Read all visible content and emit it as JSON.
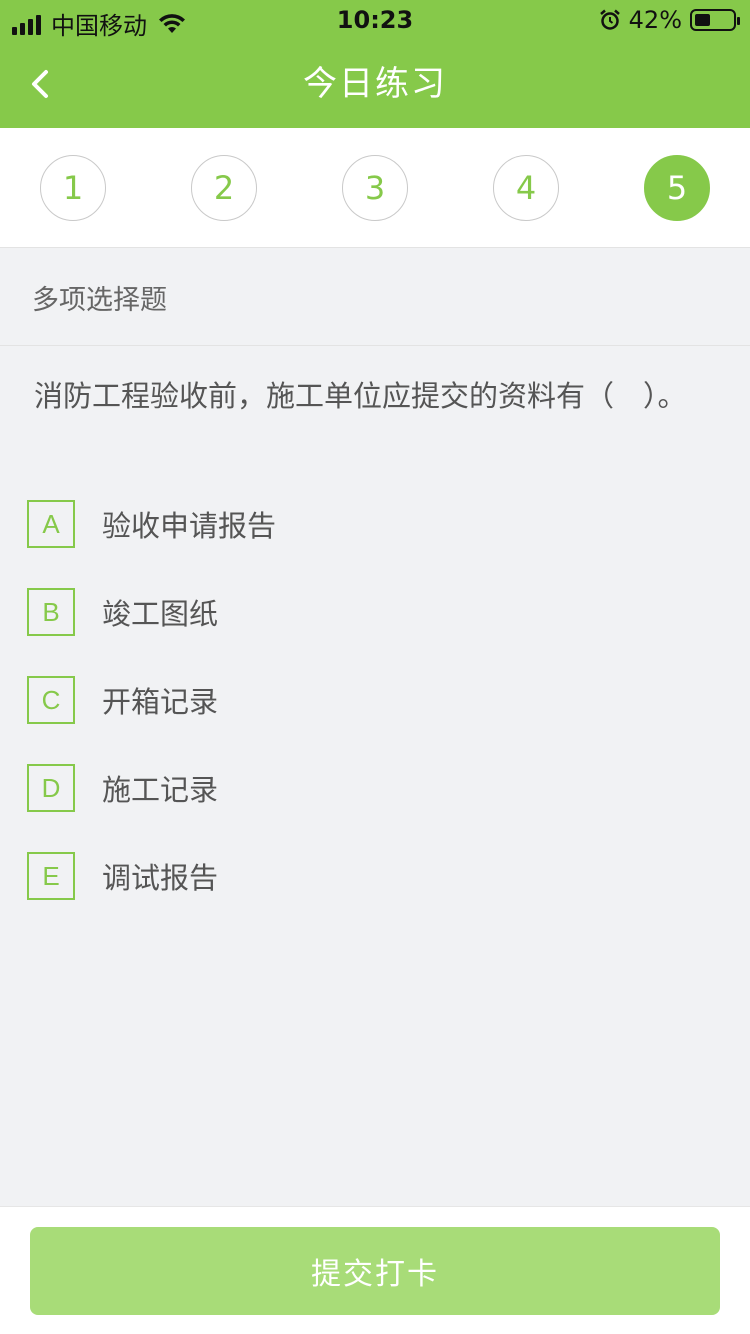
{
  "status_bar": {
    "carrier": "中国移动",
    "time": "10:23",
    "battery_percent": "42%",
    "battery_level": 0.42,
    "icons": [
      "signal-icon",
      "wifi-icon",
      "alarm-icon",
      "battery-icon"
    ]
  },
  "nav": {
    "title": "今日练习",
    "back_icon": "chevron-left-icon"
  },
  "questions": {
    "numbers": [
      "1",
      "2",
      "3",
      "4",
      "5"
    ],
    "active": "5"
  },
  "question": {
    "type": "多项选择题",
    "text": "消防工程验收前，施工单位应提交的资料有（　）。",
    "options": [
      {
        "letter": "A",
        "text": "验收申请报告"
      },
      {
        "letter": "B",
        "text": "竣工图纸"
      },
      {
        "letter": "C",
        "text": "开箱记录"
      },
      {
        "letter": "D",
        "text": "施工记录"
      },
      {
        "letter": "E",
        "text": "调试报告"
      }
    ]
  },
  "footer": {
    "submit_label": "提交打卡"
  },
  "colors": {
    "brand_green": "#86c94a",
    "button_disabled": "#a8dc78",
    "background": "#f1f2f4"
  }
}
